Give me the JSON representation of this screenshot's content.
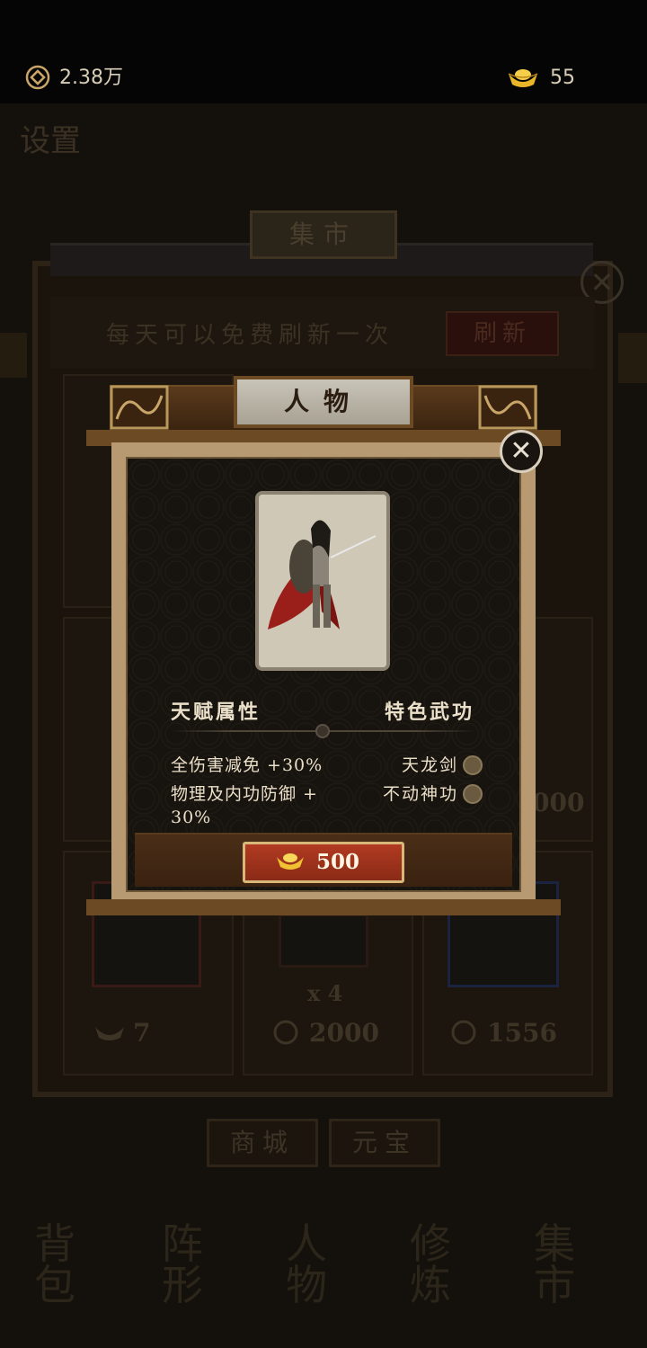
{
  "status_bar": {
    "coins": "2.38万",
    "ingots": "55"
  },
  "background": {
    "settings_label": "设置",
    "market_title": "集市",
    "refresh_hint": "每天可以免费刷新一次",
    "refresh_button": "刷新",
    "prices": [
      {
        "icon": "ingot-icon",
        "value": "7"
      },
      {
        "icon": "coin-icon",
        "value": "2000"
      },
      {
        "icon": "coin-icon",
        "value": "1556"
      }
    ],
    "partial_price": "000",
    "quantity": "x 4",
    "tabs": [
      "商城",
      "元宝"
    ],
    "bottom_nav": [
      "背包",
      "阵形",
      "人物",
      "修炼",
      "集市"
    ]
  },
  "dialog": {
    "title": "人物",
    "talent_header": "天赋属性",
    "skill_header": "特色武功",
    "talents": [
      "全伤害减免 +30%",
      "物理及内功防御 +\n30%"
    ],
    "skills": [
      "天龙剑",
      "不动神功"
    ],
    "price": "500",
    "close_symbol": "✕"
  },
  "colors": {
    "buy_button": "#b23a22",
    "frame": "#b79a72",
    "wood": "#6b4a24"
  }
}
